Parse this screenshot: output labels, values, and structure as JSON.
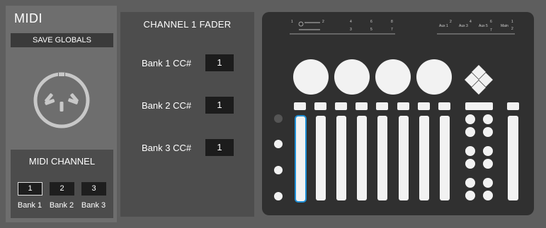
{
  "app": {
    "title": "MIDI"
  },
  "globals": {
    "save_label": "SAVE GLOBALS"
  },
  "midi_channel": {
    "title": "MIDI CHANNEL",
    "buttons": [
      {
        "value": "1",
        "label": "Bank 1",
        "selected": true
      },
      {
        "value": "2",
        "label": "Bank 2",
        "selected": false
      },
      {
        "value": "3",
        "label": "Bank 3",
        "selected": false
      }
    ]
  },
  "fader": {
    "title": "CHANNEL 1 FADER",
    "banks": [
      {
        "label": "Bank 1 CC#",
        "value": "1"
      },
      {
        "label": "Bank 2 CC#",
        "value": "1"
      },
      {
        "label": "Bank 3 CC#",
        "value": "1"
      }
    ]
  },
  "device": {
    "top_labels": [
      "1",
      "2",
      "4",
      "3",
      "6",
      "5",
      "8",
      "7"
    ],
    "aux_labels": [
      "Aux 1",
      "2",
      "Aux 3",
      "4",
      "Aux 5",
      "6",
      "7",
      "Main",
      "1",
      "2"
    ],
    "selected_fader": 1,
    "colors": {
      "highlight": "#1e8fd6",
      "body": "#303030",
      "control": "#f2f2f2"
    }
  }
}
